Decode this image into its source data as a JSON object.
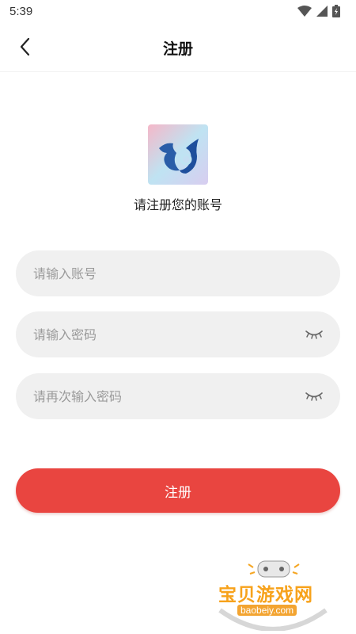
{
  "status": {
    "time": "5:39",
    "icons": [
      "wifi-icon",
      "signal-icon",
      "battery-icon"
    ]
  },
  "nav": {
    "title": "注册",
    "back_icon": "chevron-left-icon"
  },
  "header": {
    "logo": "app-logo",
    "subtitle": "请注册您的账号"
  },
  "form": {
    "account_placeholder": "请输入账号",
    "password_placeholder": "请输入密码",
    "confirm_placeholder": "请再次输入密码",
    "eye_icon": "eye-closed-icon"
  },
  "actions": {
    "register_label": "注册"
  },
  "watermark": {
    "text": "宝贝游戏网",
    "url": "baobeiy.com"
  },
  "colors": {
    "primary": "#e94540",
    "field_bg": "#f0f0f0",
    "placeholder": "#9a9a9a"
  }
}
